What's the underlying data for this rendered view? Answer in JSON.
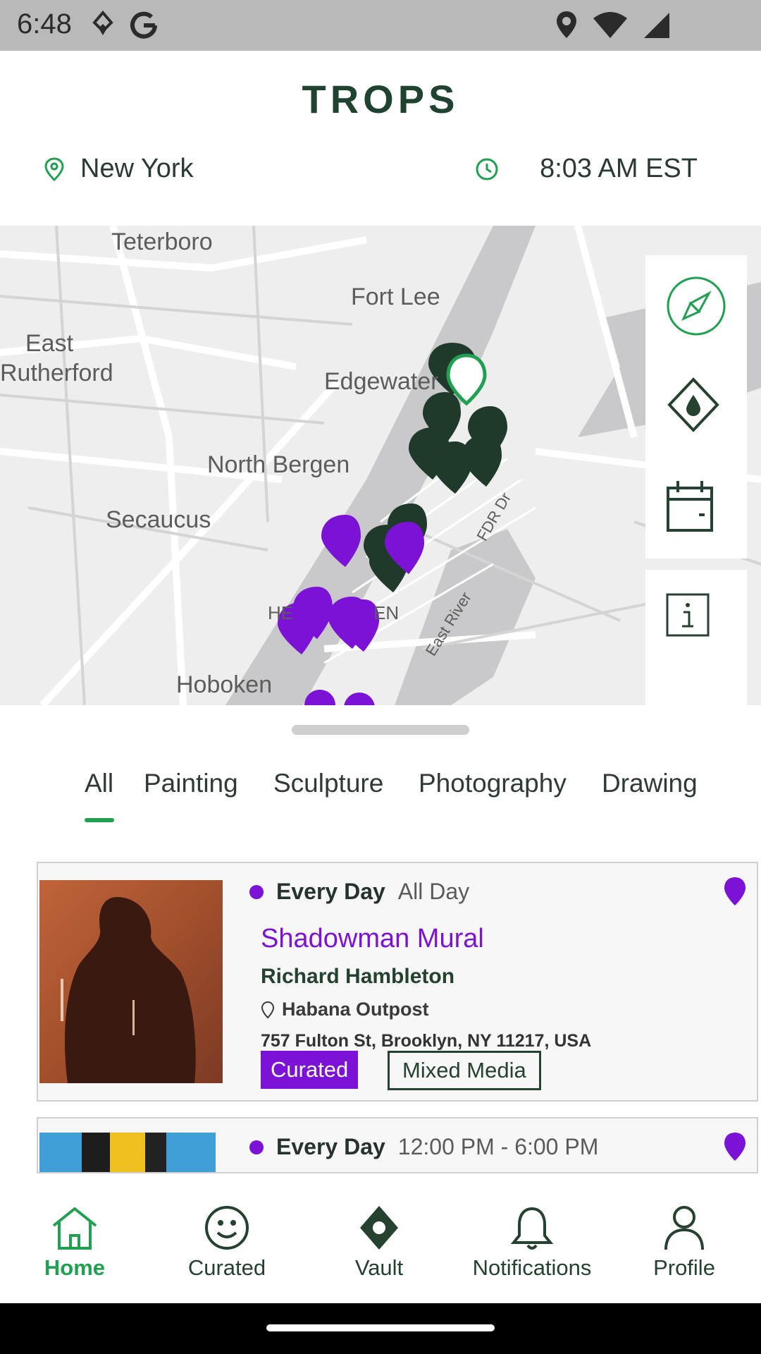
{
  "status_bar": {
    "time": "6:48"
  },
  "header": {
    "title": "TROPS",
    "location": "New York",
    "time": "8:03 AM EST"
  },
  "map": {
    "labels": [
      "Teterboro",
      "Fort Lee",
      "East",
      "Rutherford",
      "Edgewater",
      "North Bergen",
      "Secaucus",
      "HE",
      "EN",
      "Hoboken",
      "FDR Dr",
      "East River"
    ]
  },
  "tabs": [
    "All",
    "Painting",
    "Sculpture",
    "Photography",
    "Drawing"
  ],
  "listings": [
    {
      "schedule_day": "Every Day",
      "schedule_time": "All Day",
      "title": "Shadowman Mural",
      "artist": "Richard Hambleton",
      "venue": "Habana Outpost",
      "address": "757 Fulton St, Brooklyn, NY 11217, USA",
      "tags": [
        "Curated",
        "Mixed Media"
      ]
    },
    {
      "schedule_day": "Every Day",
      "schedule_time": "12:00 PM - 6:00 PM"
    }
  ],
  "nav": [
    "Home",
    "Curated",
    "Vault",
    "Notifications",
    "Profile"
  ],
  "colors": {
    "brand_green": "#1f4330",
    "accent_green": "#20a050",
    "purple": "#7b12d6"
  }
}
